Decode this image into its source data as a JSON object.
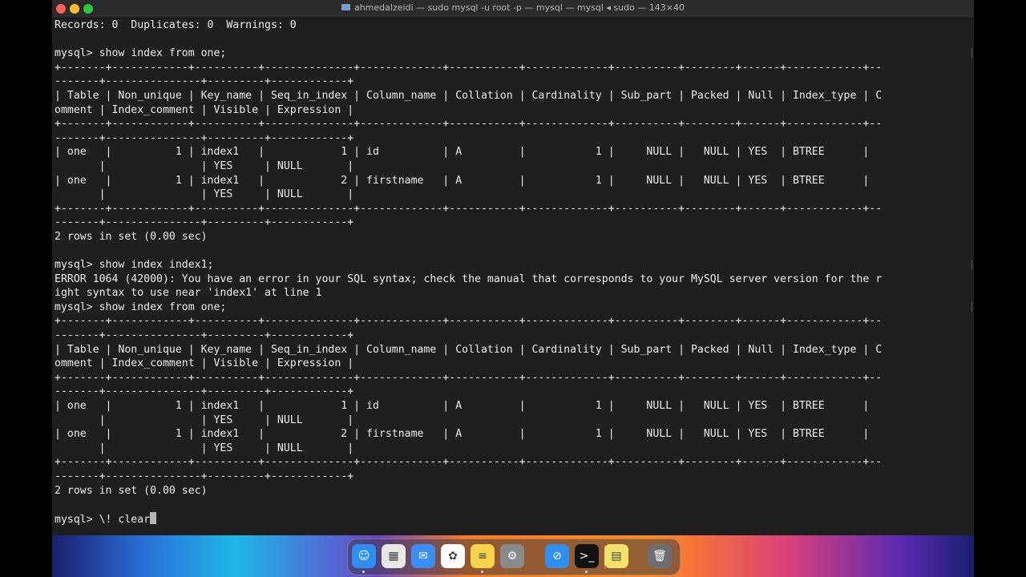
{
  "window": {
    "title": "ahmedalzeidi — sudo mysql -u root -p — mysql — mysql ◂ sudo — 143×40"
  },
  "terminal": {
    "lines": [
      "Records: 0  Duplicates: 0  Warnings: 0",
      "",
      "mysql> show index from one;",
      "+-------+------------+----------+--------------+-------------+-----------+-------------+----------+--------+------+------------+--",
      "-------+---------------+---------+------------+",
      "| Table | Non_unique | Key_name | Seq_in_index | Column_name | Collation | Cardinality | Sub_part | Packed | Null | Index_type | C",
      "omment | Index_comment | Visible | Expression |",
      "+-------+------------+----------+--------------+-------------+-----------+-------------+----------+--------+------+------------+--",
      "-------+---------------+---------+------------+",
      "| one   |          1 | index1   |            1 | id          | A         |           1 |     NULL |   NULL | YES  | BTREE      |  ",
      "       |               | YES     | NULL       |",
      "| one   |          1 | index1   |            2 | firstname   | A         |           1 |     NULL |   NULL | YES  | BTREE      |  ",
      "       |               | YES     | NULL       |",
      "+-------+------------+----------+--------------+-------------+-----------+-------------+----------+--------+------+------------+--",
      "-------+---------------+---------+------------+",
      "2 rows in set (0.00 sec)",
      "",
      "mysql> show index index1;",
      "ERROR 1064 (42000): You have an error in your SQL syntax; check the manual that corresponds to your MySQL server version for the r",
      "ight syntax to use near 'index1' at line 1",
      "mysql> show index from one;",
      "+-------+------------+----------+--------------+-------------+-----------+-------------+----------+--------+------+------------+--",
      "-------+---------------+---------+------------+",
      "| Table | Non_unique | Key_name | Seq_in_index | Column_name | Collation | Cardinality | Sub_part | Packed | Null | Index_type | C",
      "omment | Index_comment | Visible | Expression |",
      "+-------+------------+----------+--------------+-------------+-----------+-------------+----------+--------+------+------------+--",
      "-------+---------------+---------+------------+",
      "| one   |          1 | index1   |            1 | id          | A         |           1 |     NULL |   NULL | YES  | BTREE      |  ",
      "       |               | YES     | NULL       |",
      "| one   |          1 | index1   |            2 | firstname   | A         |           1 |     NULL |   NULL | YES  | BTREE      |  ",
      "       |               | YES     | NULL       |",
      "+-------+------------+----------+--------------+-------------+-----------+-------------+----------+--------+------+------------+--",
      "-------+---------------+---------+------------+",
      "2 rows in set (0.00 sec)",
      "",
      "mysql> \\! clear"
    ]
  },
  "dock": {
    "apps": [
      {
        "name": "finder-icon",
        "color": "#2f8ff0",
        "glyph": "☺",
        "running": true
      },
      {
        "name": "launchpad-icon",
        "color": "#e8e8e8",
        "glyph": "▦",
        "running": false
      },
      {
        "name": "mail-icon",
        "color": "#3a8ef6",
        "glyph": "✉",
        "running": false
      },
      {
        "name": "photos-icon",
        "color": "#ffffff",
        "glyph": "✿",
        "running": false
      },
      {
        "name": "notes-icon",
        "color": "#f6d34a",
        "glyph": "≡",
        "running": true
      },
      {
        "name": "system-settings-icon",
        "color": "#8a8a8a",
        "glyph": "⚙",
        "running": false
      },
      {
        "name": "safari-icon",
        "color": "#2f8ff0",
        "glyph": "⊘",
        "running": false
      },
      {
        "name": "terminal-icon",
        "color": "#111111",
        "glyph": ">_",
        "running": true
      },
      {
        "name": "stickies-icon",
        "color": "#f3e36a",
        "glyph": "▤",
        "running": false
      },
      {
        "name": "trash-icon",
        "color": "#6d6d72",
        "glyph": "🗑",
        "running": false
      }
    ]
  }
}
